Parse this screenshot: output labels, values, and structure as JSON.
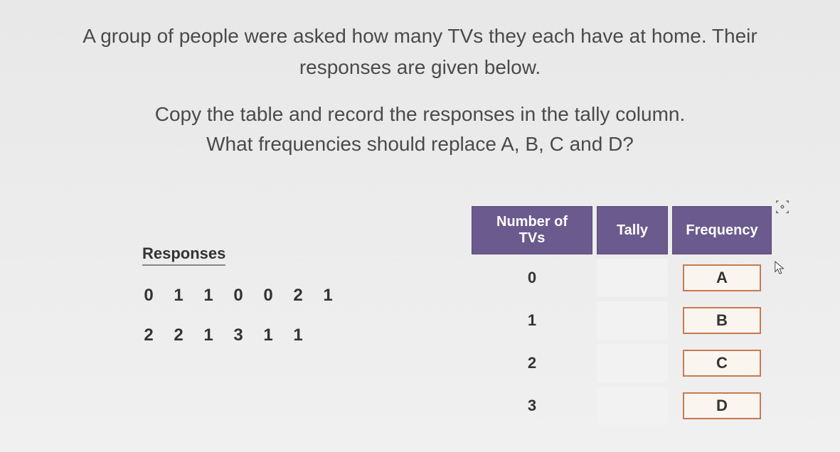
{
  "question": {
    "line1": "A group of people were asked how many TVs they each have at home. Their",
    "line2": "responses are given below.",
    "line3": "Copy the table and record the responses in the tally column.",
    "line4": "What frequencies should replace A, B, C and D?"
  },
  "responses": {
    "title": "Responses",
    "row1": [
      "0",
      "1",
      "1",
      "0",
      "0",
      "2",
      "1"
    ],
    "row2": [
      "2",
      "2",
      "1",
      "3",
      "1",
      "1"
    ]
  },
  "table": {
    "headers": {
      "col1": "Number of TVs",
      "col2": "Tally",
      "col3": "Frequency"
    },
    "rows": [
      {
        "num": "0",
        "freq": "A"
      },
      {
        "num": "1",
        "freq": "B"
      },
      {
        "num": "2",
        "freq": "C"
      },
      {
        "num": "3",
        "freq": "D"
      }
    ]
  }
}
